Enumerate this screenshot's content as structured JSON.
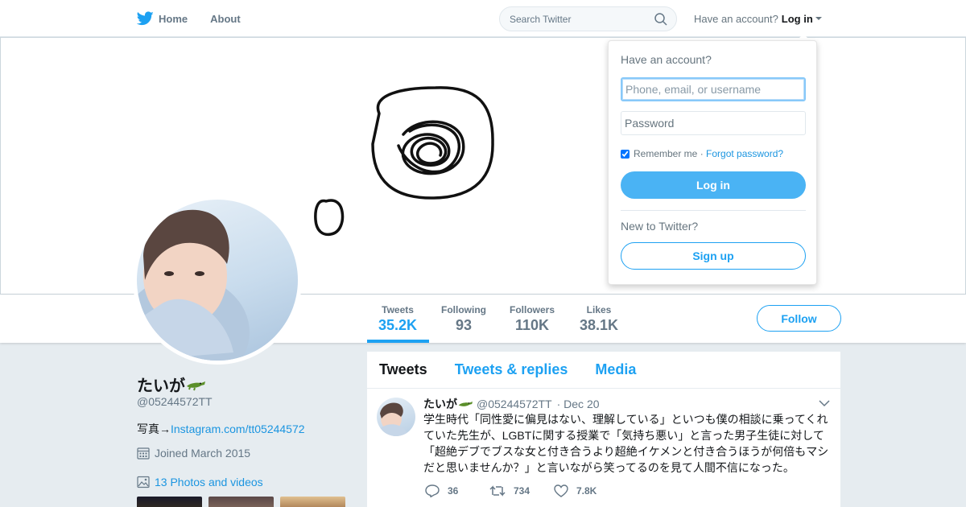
{
  "nav": {
    "home_label": "Home",
    "about_label": "About",
    "search_placeholder": "Search Twitter",
    "have_account": "Have an account?",
    "login_label": "Log in"
  },
  "profile": {
    "name": "たいが",
    "handle": "@05244572TT",
    "bio_prefix": "写真→",
    "bio_link": "Instagram.com/tt05244572",
    "joined": "Joined March 2015",
    "photos": "13 Photos and videos"
  },
  "stats": [
    {
      "label": "Tweets",
      "value": "35.2K"
    },
    {
      "label": "Following",
      "value": "93"
    },
    {
      "label": "Followers",
      "value": "110K"
    },
    {
      "label": "Likes",
      "value": "38.1K"
    }
  ],
  "follow_label": "Follow",
  "timeline": {
    "tabs": [
      "Tweets",
      "Tweets & replies",
      "Media"
    ]
  },
  "tweet": {
    "name": "たいが",
    "handle": "@05244572TT",
    "date": "· Dec 20",
    "text": "学生時代「同性愛に偏見はない、理解している」といつも僕の相談に乗ってくれていた先生が、LGBTに関する授業で「気持ち悪い」と言った男子生徒に対して「超絶デブでブスな女と付き合うより超絶イケメンと付き合うほうが何倍もマシだと思いませんか？」と言いながら笑ってるのを見て人間不信になった。",
    "replies": "36",
    "retweets": "734",
    "likes": "7.8K"
  },
  "login_dropdown": {
    "heading": "Have an account?",
    "username_placeholder": "Phone, email, or username",
    "password_placeholder": "Password",
    "remember": "Remember me",
    "separator": " · ",
    "forgot": "Forgot password?",
    "login_button": "Log in",
    "new_to_twitter": "New to Twitter?",
    "signup_button": "Sign up"
  },
  "colors": {
    "brand_blue": "#1da1f2",
    "login_button": "#4ab3f4",
    "background": "#e6ecf0"
  }
}
